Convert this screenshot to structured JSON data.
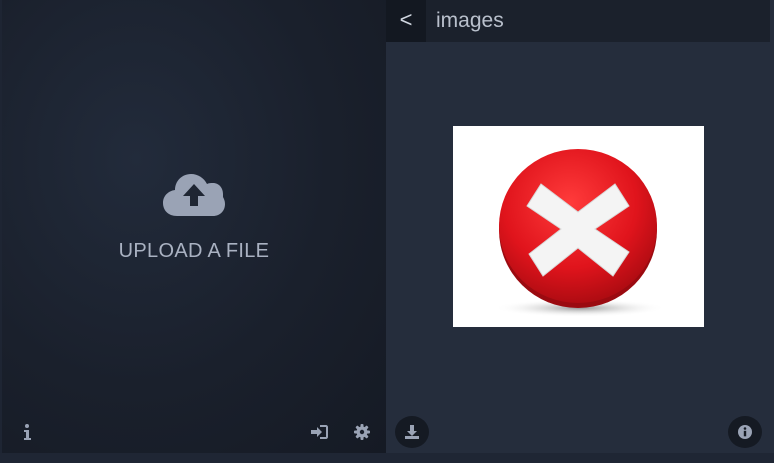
{
  "upload": {
    "label": "UPLOAD A FILE",
    "icon": "cloud-upload-icon"
  },
  "left_footer": {
    "info_icon": "info-icon",
    "login_icon": "sign-in-icon",
    "settings_icon": "gear-icon"
  },
  "viewer": {
    "back_label": "<",
    "title": "images",
    "preview_icon": "red-x-error-icon",
    "download_icon": "download-icon",
    "info_icon": "info-circle-icon"
  },
  "colors": {
    "background": "#1e2533",
    "viewer_background": "#252d3c",
    "header_background": "#1b212c",
    "icon_gray": "#9aa3b5",
    "error_red": "#e0141c"
  }
}
